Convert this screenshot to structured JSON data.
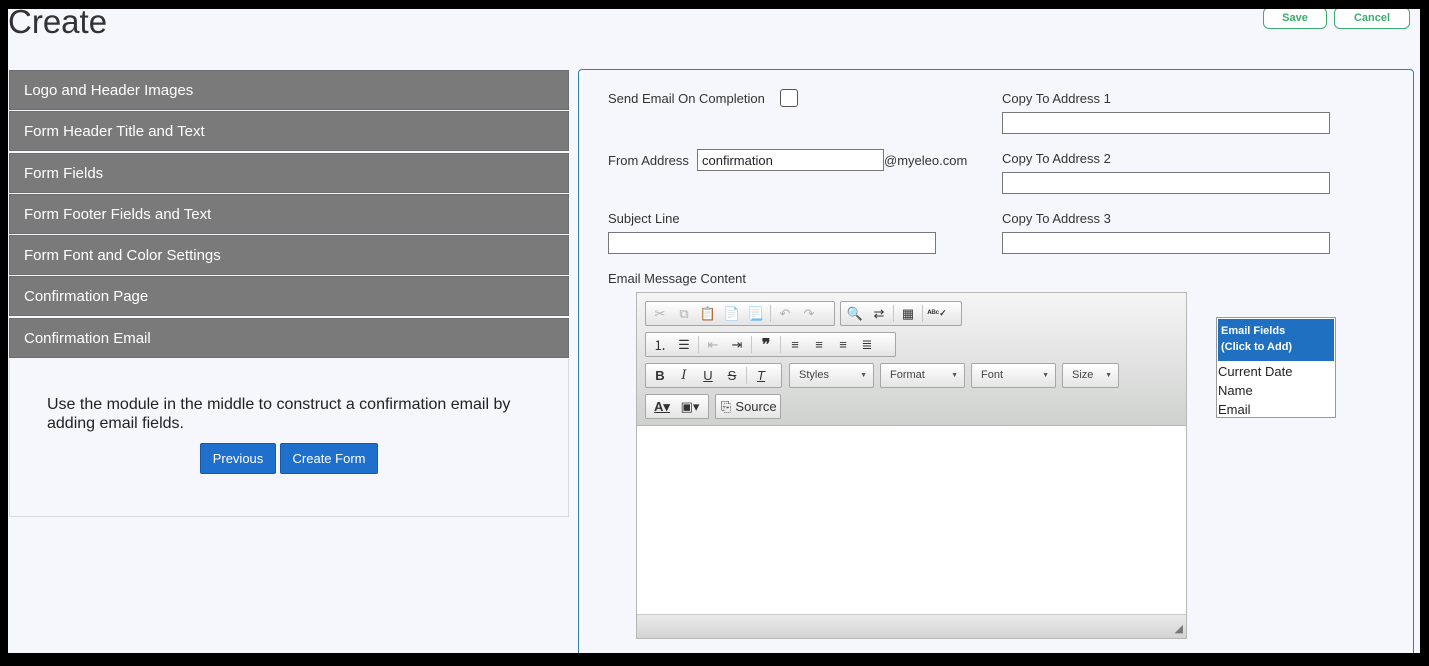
{
  "page": {
    "title": "Create"
  },
  "toolbar": {
    "save_label": "Save",
    "cancel_label": "Cancel"
  },
  "accordion": {
    "items": [
      "Logo and Header Images",
      "Form Header Title and Text",
      "Form Fields",
      "Form Footer Fields and Text",
      "Form Font and Color Settings",
      "Confirmation Page",
      "Confirmation Email"
    ],
    "panel_text": "Use the module in the middle to construct a confirmation email by adding email fields.",
    "previous_label": "Previous",
    "create_label": "Create Form"
  },
  "email_settings": {
    "send_email_label": "Send Email On Completion",
    "from_label": "From Address",
    "from_value": "confirmation",
    "from_domain": "@myeleo.com",
    "subject_label": "Subject Line",
    "subject_value": "",
    "copy1_label": "Copy To Address 1",
    "copy2_label": "Copy To Address 2",
    "copy3_label": "Copy To Address 3",
    "content_label": "Email Message Content"
  },
  "editor": {
    "styles_label": "Styles",
    "format_label": "Format",
    "font_label": "Font",
    "size_label": "Size",
    "source_label": "Source"
  },
  "email_fields": {
    "header_line1": "Email Fields",
    "header_line2": "(Click to Add)",
    "items": [
      "Current Date",
      "Name",
      "Email"
    ]
  },
  "colors": {
    "accordion_bg": "#7a7a7a",
    "primary_blue": "#1f6fcc",
    "save_green": "#3cab6e",
    "panel_border": "#2f7fa6"
  }
}
